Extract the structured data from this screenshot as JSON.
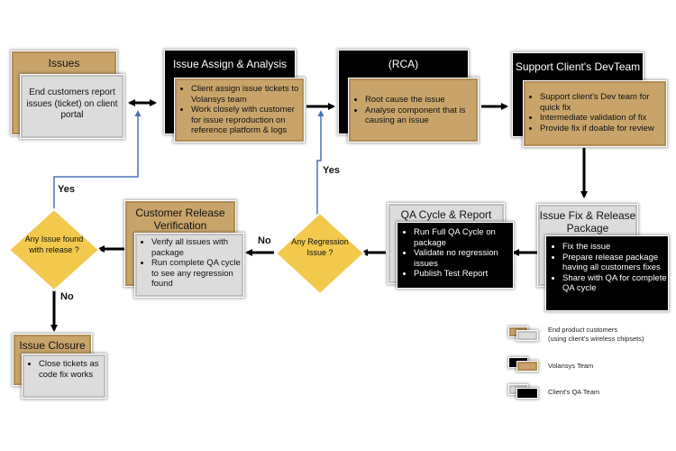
{
  "nodes": {
    "issues": {
      "title": "Issues",
      "body": "End customers report issues (ticket) on client portal"
    },
    "assign": {
      "title": "Issue Assign & Analysis",
      "bullets": [
        "Client assign issue tickets to Volansys team",
        "Work closely with customer for issue reproduction on reference platform & logs"
      ]
    },
    "rca": {
      "title": "(RCA)",
      "bullets": [
        "Root cause the issue",
        "Analyse component that is causing an issue"
      ]
    },
    "support": {
      "title": "Support Client's DevTeam",
      "bullets": [
        "Support client's Dev team for quick fix",
        "Intermediate validation of fix",
        "Provide fix if doable for review"
      ]
    },
    "fix": {
      "title": "Issue Fix & Release Package",
      "bullets": [
        "Fix the issue",
        "Prepare release package having all customers fixes",
        "Share with QA for complete QA cycle"
      ]
    },
    "qa": {
      "title": "QA Cycle & Report",
      "bullets": [
        "Run Full QA Cycle on package",
        "Validate no regression issues",
        "Publish Test Report"
      ]
    },
    "verify": {
      "title": "Customer Release Verification",
      "bullets": [
        "Verify all issues with package",
        "Run complete QA cycle to see any regression found"
      ]
    },
    "closure": {
      "title": "Issue Closure",
      "bullets": [
        "Close tickets as code fix works"
      ]
    }
  },
  "decisions": {
    "regression": "Any Regression Issue ?",
    "release": "Any Issue found with release ?"
  },
  "labels": {
    "yes_regression": "Yes",
    "no_regression": "No",
    "yes_release": "Yes",
    "no_release": "No"
  },
  "legend": [
    {
      "label": "End product customers",
      "sublabel": "(using client's wireless chipsets)"
    },
    {
      "label": "Volansys Team"
    },
    {
      "label": "Client's QA Team"
    }
  ],
  "colors": {
    "gold": "#c8a46a",
    "grey": "#dcdcdc",
    "black": "#000000",
    "diamond": "#f2c94c",
    "yes_line": "#4a72b8"
  }
}
